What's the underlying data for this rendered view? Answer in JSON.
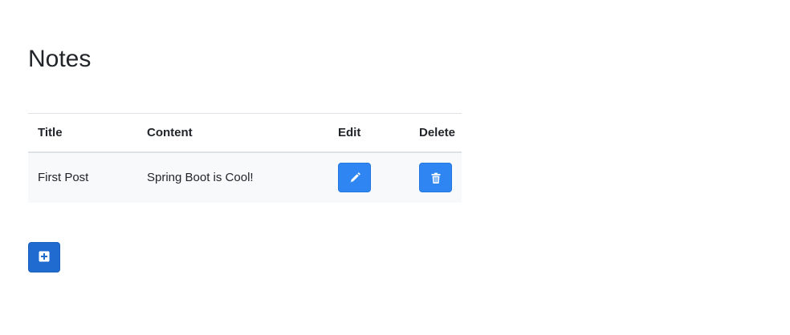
{
  "page": {
    "title": "Notes"
  },
  "table": {
    "headers": {
      "title": "Title",
      "content": "Content",
      "edit": "Edit",
      "delete": "Delete"
    },
    "rows": [
      {
        "title": "First Post",
        "content": "Spring Boot is Cool!"
      }
    ]
  },
  "icons": {
    "edit": "pencil-icon",
    "delete": "trash-icon",
    "add": "plus-square-icon"
  },
  "colors": {
    "button": "#2f86f2",
    "add_button": "#1f6bd0",
    "row_background": "#f8f9fa"
  }
}
